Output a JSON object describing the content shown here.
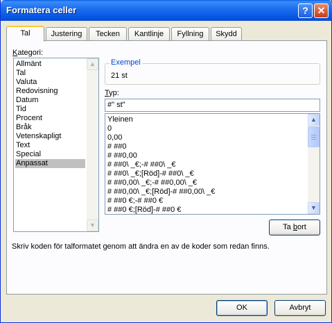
{
  "window": {
    "title": "Formatera celler",
    "help_glyph": "?",
    "close_glyph": "✕"
  },
  "tabs": [
    {
      "label": "Tal",
      "active": true
    },
    {
      "label": "Justering",
      "active": false
    },
    {
      "label": "Tecken",
      "active": false
    },
    {
      "label": "Kantlinje",
      "active": false
    },
    {
      "label": "Fyllning",
      "active": false
    },
    {
      "label": "Skydd",
      "active": false
    }
  ],
  "category": {
    "label_prefix": "",
    "label_access": "K",
    "label_rest": "ategori:",
    "items": [
      "Allmänt",
      "Tal",
      "Valuta",
      "Redovisning",
      "Datum",
      "Tid",
      "Procent",
      "Bråk",
      "Vetenskapligt",
      "Text",
      "Special",
      "Anpassat"
    ],
    "selected": "Anpassat"
  },
  "sample": {
    "legend": "Exempel",
    "value": "21 st"
  },
  "type": {
    "label_access": "T",
    "label_rest": "yp:",
    "value": "#\" st\"",
    "items": [
      "Yleinen",
      "0",
      "0,00",
      "# ##0",
      "# ##0,00",
      "# ##0\\ _€;-# ##0\\ _€",
      "# ##0\\ _€;[Röd]-# ##0\\ _€",
      "# ##0,00\\ _€;-# ##0,00\\ _€",
      "# ##0,00\\ _€;[Röd]-# ##0,00\\ _€",
      "# ##0 €;-# ##0 €",
      "# ##0 €;[Röd]-# ##0 €"
    ]
  },
  "delete_button": {
    "label_prefix": "Ta ",
    "label_access": "b",
    "label_rest": "ort"
  },
  "description": "Skriv koden för talformatet genom att ändra en av de koder som redan finns.",
  "ok_label": "OK",
  "cancel_label": "Avbryt",
  "scroll": {
    "up_glyph": "▲",
    "down_glyph": "▼"
  }
}
